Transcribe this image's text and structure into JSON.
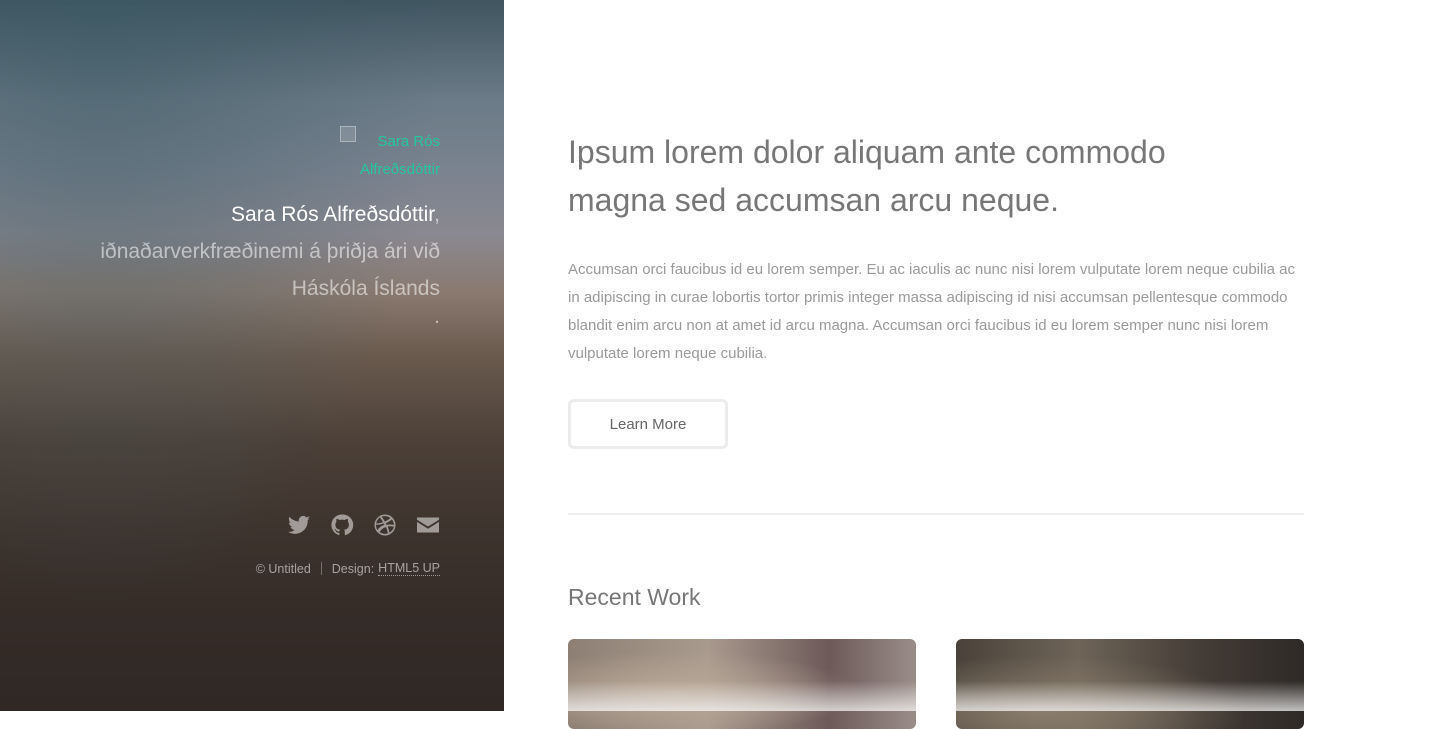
{
  "sidebar": {
    "avatar_alt": "Sara Rós Alfreðsdóttir",
    "name": "Sara Rós Alfreðsdóttir",
    "comma": ",",
    "tagline": " iðnaðarverkfræðinemi á þriðja ári við Háskóla Íslands",
    "period": ".",
    "social": [
      "twitter-icon",
      "github-icon",
      "dribbble-icon",
      "envelope-icon"
    ],
    "footer": {
      "copyright": "© Untitled",
      "design_label": "Design:",
      "design_link": "HTML5 UP"
    }
  },
  "main": {
    "headline": "Ipsum lorem dolor aliquam ante commodo magna sed accumsan arcu neque.",
    "body": "Accumsan orci faucibus id eu lorem semper. Eu ac iaculis ac nunc nisi lorem vulputate lorem neque cubilia ac in adipiscing in curae lobortis tortor primis integer massa adipiscing id nisi accumsan pellentesque commodo blandit enim arcu non at amet id arcu magna. Accumsan orci faucibus id eu lorem semper nunc nisi lorem vulputate lorem neque cubilia.",
    "button_label": "Learn More",
    "section_title": "Recent Work"
  },
  "colors": {
    "accent": "#25c79f",
    "heading": "#777777",
    "body_text": "#9a9a9a"
  }
}
